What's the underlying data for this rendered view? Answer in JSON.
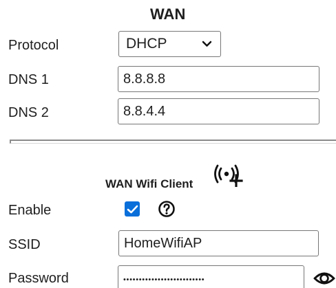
{
  "wan": {
    "title": "WAN",
    "protocol_label": "Protocol",
    "protocol_value": "DHCP",
    "dns1_label": "DNS 1",
    "dns1_value": "8.8.8.8",
    "dns2_label": "DNS 2",
    "dns2_value": "8.8.4.4"
  },
  "wifi_client": {
    "title": "WAN Wifi Client",
    "enable_label": "Enable",
    "enabled": true,
    "ssid_label": "SSID",
    "ssid_value": "HomeWifiAP",
    "password_label": "Password",
    "password_masked": "••••••••••••••••••••••••••"
  },
  "icons": {
    "select": "chevron-down-icon",
    "wireless": "wifi-antenna-plus-icon",
    "checkbox": "checkmark-icon",
    "help": "help-icon",
    "password_visibility": "eye-icon"
  },
  "colors": {
    "accent": "#0b6fda",
    "text": "#1f1f1f",
    "border": "#767676"
  }
}
